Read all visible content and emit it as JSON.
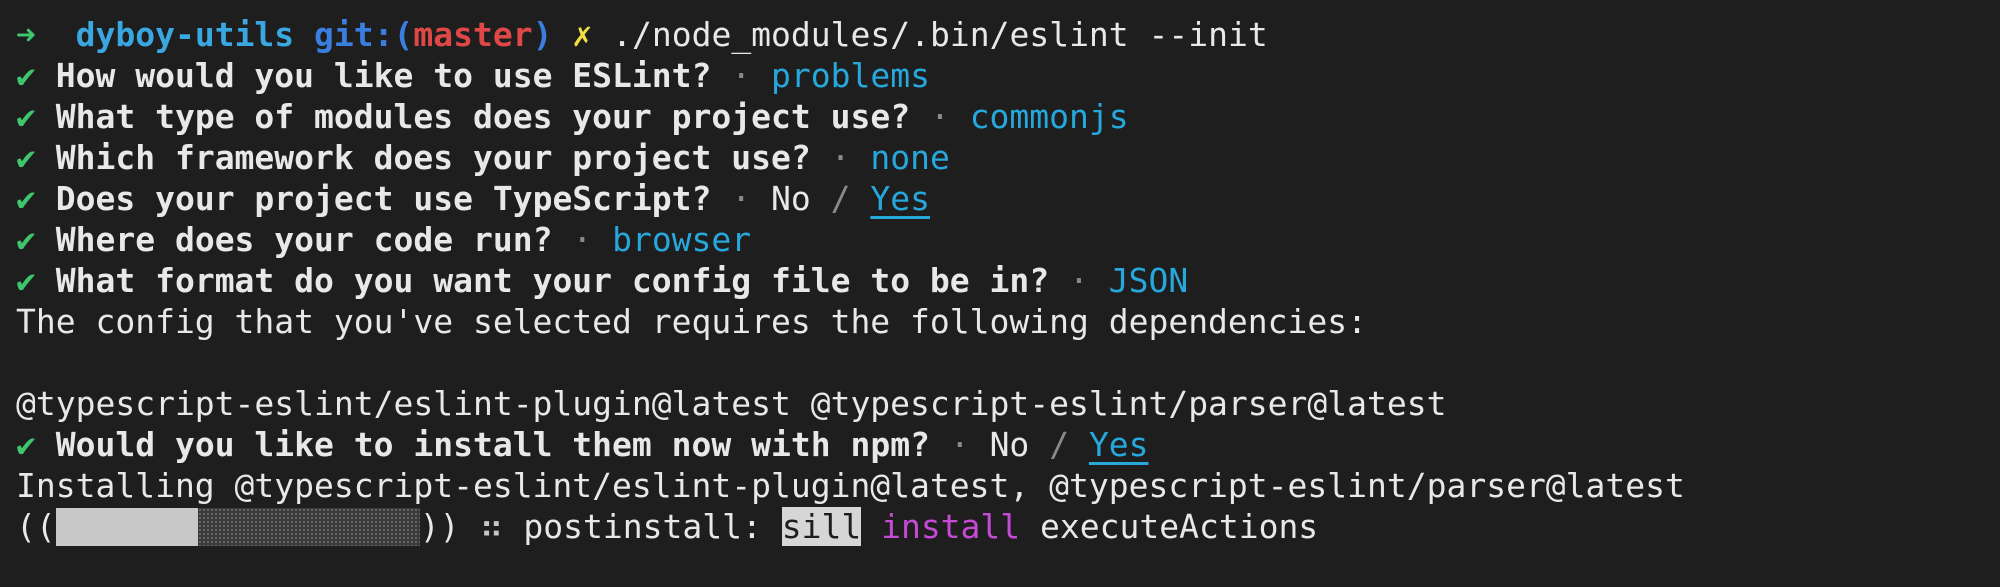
{
  "prompt": {
    "arrow": "➜",
    "directory": "dyboy-utils",
    "git_label": "git:(",
    "branch": "master",
    "git_close": ")",
    "dirty_mark": "✗",
    "command": "./node_modules/.bin/eslint --init"
  },
  "questions": [
    {
      "check": "✔",
      "text": "How would you like to use ESLint?",
      "sep": "·",
      "answer": "problems"
    },
    {
      "check": "✔",
      "text": "What type of modules does your project use?",
      "sep": "·",
      "answer": "commonjs"
    },
    {
      "check": "✔",
      "text": "Which framework does your project use?",
      "sep": "·",
      "answer": "none"
    },
    {
      "check": "✔",
      "text": "Does your project use TypeScript?",
      "sep": "·",
      "no": "No",
      "slash": "/",
      "yes": "Yes"
    },
    {
      "check": "✔",
      "text": "Where does your code run?",
      "sep": "·",
      "answer": "browser"
    },
    {
      "check": "✔",
      "text": "What format do you want your config file to be in?",
      "sep": "·",
      "answer": "JSON"
    }
  ],
  "deps_message": "The config that you've selected requires the following dependencies:",
  "deps_list": "@typescript-eslint/eslint-plugin@latest @typescript-eslint/parser@latest",
  "install_question": {
    "check": "✔",
    "text": "Would you like to install them now with npm?",
    "sep": "·",
    "no": "No",
    "slash": "/",
    "yes": "Yes"
  },
  "installing_line": "Installing @typescript-eslint/eslint-plugin@latest, @typescript-eslint/parser@latest",
  "progress": {
    "open": "((",
    "close": "))",
    "fraction": 0.39,
    "spinner": "⠶",
    "stage": "postinstall:",
    "level": "sill",
    "action": "install",
    "detail": "executeActions"
  },
  "colors": {
    "background": "#1e1e1e",
    "foreground": "#e8e8e8",
    "check": "#3fc56b",
    "answer": "#26a8dc",
    "branch": "#e04848",
    "dirty": "#f0e040",
    "install": "#c64ad6"
  }
}
